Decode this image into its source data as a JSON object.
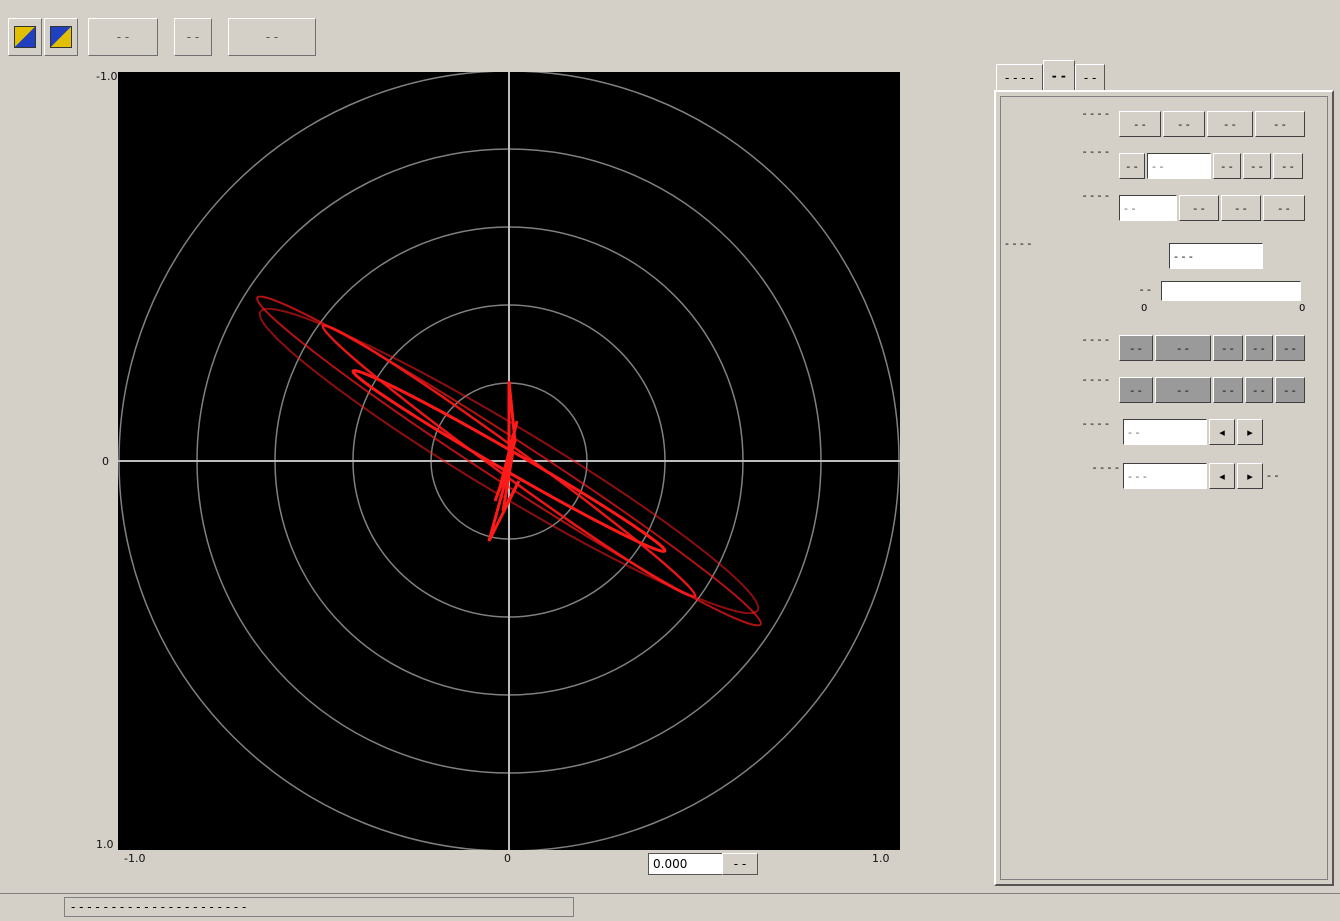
{
  "toolbar": {
    "btn_1_icon": "open-file-icon",
    "btn_2_icon": "save-icon",
    "btn_3_label": "- -",
    "btn_4_label": "- -",
    "btn_5_label": "- -"
  },
  "plot": {
    "y_top": "-1.0",
    "y_mid": "0",
    "y_bottom": "1.0",
    "x_left": "-1.0",
    "x_mid": "0",
    "x_right": "1.0",
    "trace_color": "#ff1a1a",
    "grid_color": "#808080"
  },
  "readout": {
    "value": "0.000",
    "button_label": "- -"
  },
  "status": {
    "text": "- - - - - - - - - - - - - - - - - - - - - -"
  },
  "tabs": [
    {
      "label": "- - - -"
    },
    {
      "label": "- -"
    },
    {
      "label": "- -"
    }
  ],
  "panel": {
    "row1": {
      "label": "- - - -",
      "buttons": [
        "- -",
        "- -",
        "- -",
        "- -"
      ]
    },
    "row2": {
      "label": "- - - -",
      "buttons": [
        "- -",
        "- -",
        "- -",
        "- -",
        "- -"
      ]
    },
    "row3": {
      "label": "- - - -",
      "buttons": [
        "- -",
        "- -",
        "- -",
        "- -"
      ]
    },
    "row4": {
      "label": "- - - -",
      "field": "- - -"
    },
    "slider": {
      "label": "- -",
      "min": "0",
      "max": "0"
    },
    "row5": {
      "label": "- - - -",
      "buttons": [
        "- -",
        "- -",
        "- -",
        "- -",
        "- -"
      ]
    },
    "row6": {
      "label": "- - - -",
      "buttons": [
        "- -",
        "- -",
        "- -",
        "- -",
        "- -"
      ]
    },
    "row7": {
      "label": "- - - -",
      "field": "- -",
      "buttons": [
        "◂",
        "▸"
      ]
    },
    "row8": {
      "label": "- - - -",
      "field": "- - -",
      "buttons": [
        "◂",
        "▸"
      ],
      "suffix": "- -"
    }
  }
}
